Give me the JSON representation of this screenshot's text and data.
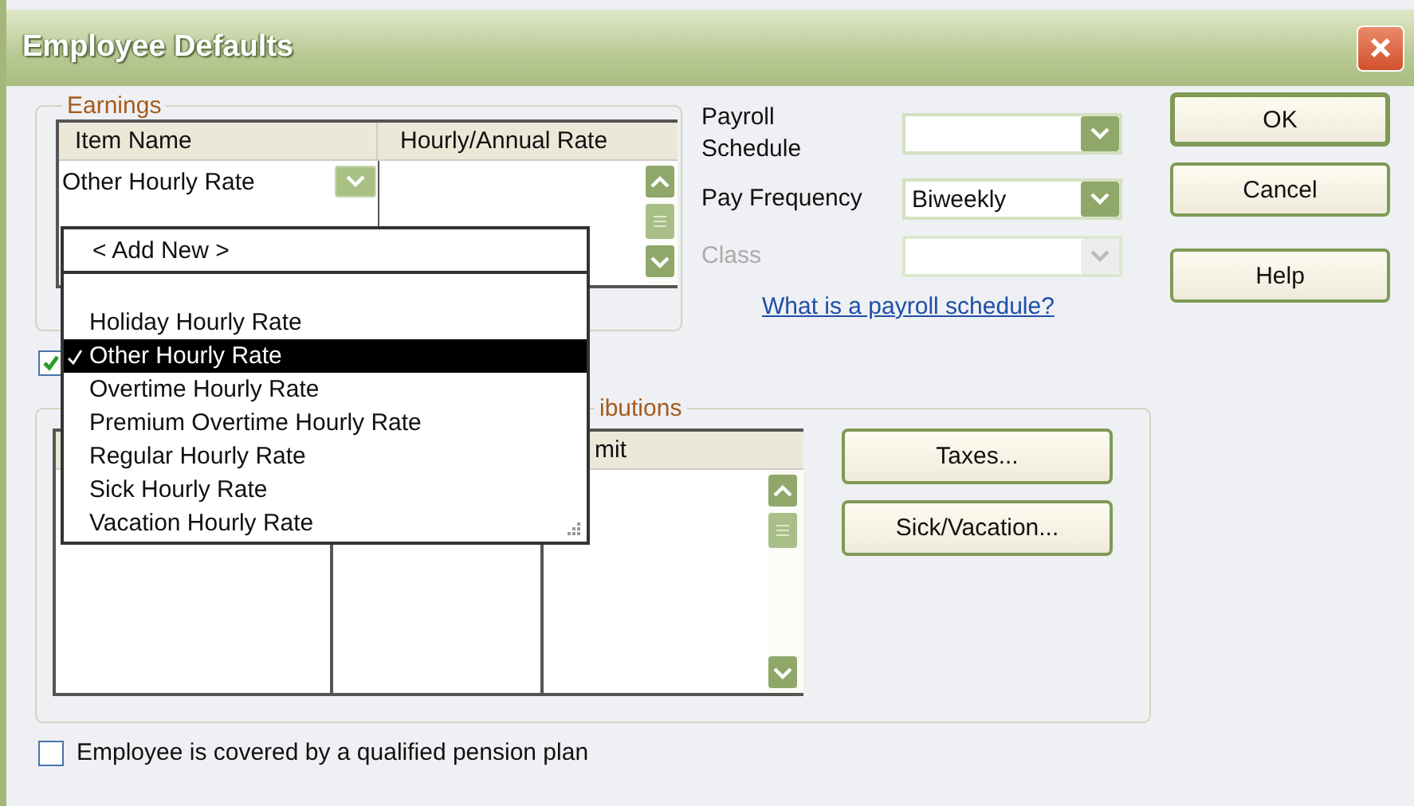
{
  "window": {
    "title": "Employee Defaults"
  },
  "earnings": {
    "legend": "Earnings",
    "columns": [
      "Item Name",
      "Hourly/Annual Rate"
    ],
    "rows": [
      {
        "item_name": "Other Hourly Rate"
      }
    ]
  },
  "item_dropdown": {
    "add_new": "< Add New >",
    "options": [
      {
        "label": "Holiday Hourly Rate",
        "selected": false
      },
      {
        "label": "Other Hourly Rate",
        "selected": true
      },
      {
        "label": "Overtime Hourly Rate",
        "selected": false
      },
      {
        "label": "Premium Overtime Hourly Rate",
        "selected": false
      },
      {
        "label": "Regular Hourly Rate",
        "selected": false
      },
      {
        "label": "Sick Hourly Rate",
        "selected": false
      },
      {
        "label": "Vacation Hourly Rate",
        "selected": false
      }
    ]
  },
  "hidden_checkbox": {
    "checked": true
  },
  "fields": [
    {
      "label": "Payroll Schedule",
      "disabled": false
    },
    {
      "label": "Pay Frequency",
      "value": "Biweekly",
      "disabled": false
    },
    {
      "label": "Class",
      "disabled": true
    }
  ],
  "help_link": "What is a payroll schedule?",
  "buttons": [
    "OK",
    "Cancel",
    "Help"
  ],
  "additions": {
    "legend": "ibutions",
    "column_3": "mit"
  },
  "side_buttons": [
    "Taxes...",
    "Sick/Vacation..."
  ],
  "pension": {
    "label": "Employee is covered by a qualified pension plan",
    "checked": false
  }
}
